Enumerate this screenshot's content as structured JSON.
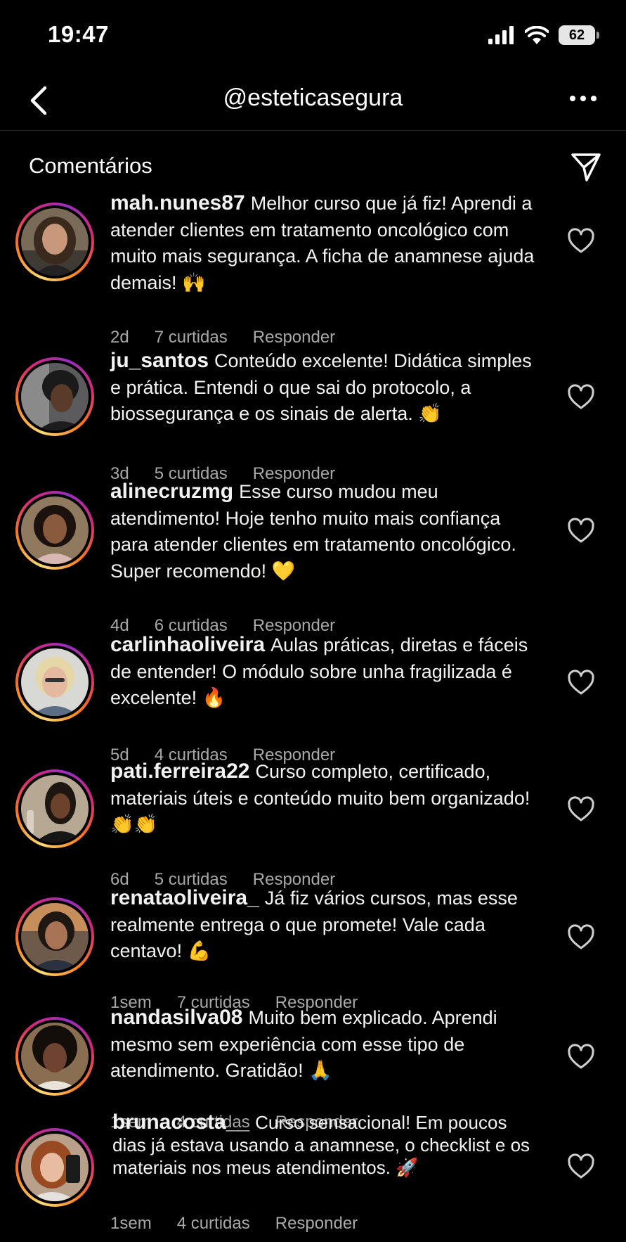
{
  "status": {
    "time": "19:47",
    "battery": "62"
  },
  "header": {
    "title": "@esteticasegura"
  },
  "section": {
    "title": "Comentários"
  },
  "comments": [
    {
      "username": "mah.nunes87",
      "text": "Melhor curso que já fiz! Aprendi a atender clientes em tratamento oncológico com muito mais segurança. A ficha de anamnese ajuda demais! 🙌",
      "time": "2d",
      "likes": "7 curtidas",
      "reply": "Responder"
    },
    {
      "username": "ju_santos",
      "text": "Conteúdo excelente! Didática simples e prática. Entendi o que sai do protocolo, a biossegurança e os sinais de alerta. 👏",
      "time": "3d",
      "likes": "5 curtidas",
      "reply": "Responder"
    },
    {
      "username": "alinecruzmg",
      "text": "Esse curso mudou meu atendimento! Hoje tenho muito mais confiança para atender clientes em tratamento oncológico. Super recomendo! 💛",
      "time": "4d",
      "likes": "6 curtidas",
      "reply": "Responder"
    },
    {
      "username": "carlinhaoliveira",
      "text": "Aulas práticas, diretas e fáceis de entender! O módulo sobre unha fragilizada é excelente! 🔥",
      "time": "5d",
      "likes": "4 curtidas",
      "reply": "Responder"
    },
    {
      "username": "pati.ferreira22",
      "text": "Curso completo, certificado, materiais úteis e conteúdo muito bem organizado! 👏👏",
      "time": "6d",
      "likes": "5 curtidas",
      "reply": "Responder"
    },
    {
      "username": "renataoliveira_",
      "text": "Já fiz vários cursos, mas esse realmente entrega o que promete! Vale cada centavo! 💪",
      "time": "1sem",
      "likes": "7 curtidas",
      "reply": "Responder"
    },
    {
      "username": "nandasilva08",
      "text": "Muito bem explicado. Aprendi mesmo sem experiência com esse tipo de atendimento. Gratidão! 🙏",
      "time": "1sem",
      "likes": "4 curtidas",
      "reply": "Responder"
    },
    {
      "username": "brunacosta__",
      "text": "Curso sensacional! Em poucos dias já estava usando a anamnese, o checklist e os materiais nos meus atendimentos. 🚀",
      "time": "1sem",
      "likes": "4 curtidas",
      "reply": "Responder"
    }
  ]
}
